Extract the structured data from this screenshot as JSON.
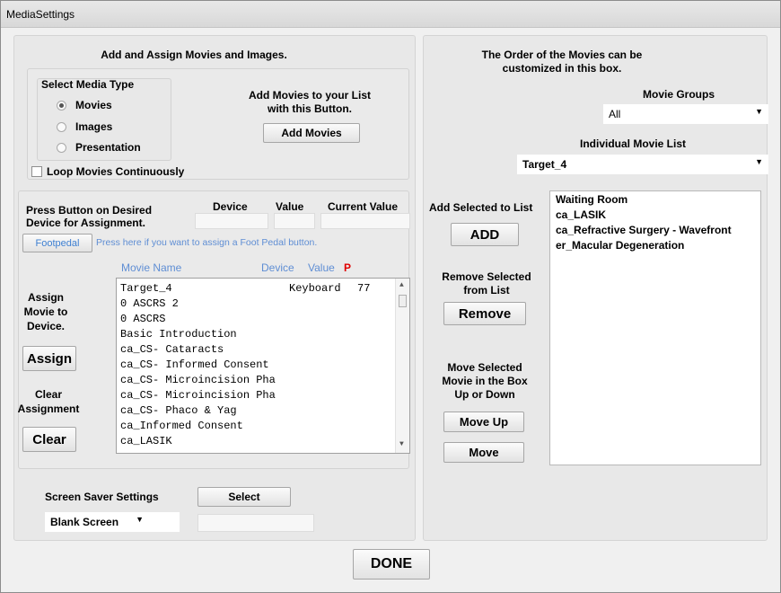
{
  "window": {
    "title": "MediaSettings"
  },
  "left_panel": {
    "heading": "Add and Assign Movies and Images.",
    "media_type": {
      "legend": "Select Media Type",
      "options": [
        {
          "label": "Movies",
          "selected": true
        },
        {
          "label": "Images",
          "selected": false
        },
        {
          "label": "Presentation",
          "selected": false
        }
      ]
    },
    "add_movies": {
      "text_line1": "Add Movies to your List",
      "text_line2": "with this Button.",
      "button": "Add Movies"
    },
    "loop": {
      "label": "Loop Movies Continuously",
      "checked": false
    },
    "assignment": {
      "instruction_line1": "Press Button on Desired",
      "instruction_line2": "Device for Assignment.",
      "col_device": "Device",
      "col_value": "Value",
      "col_current": "Current Value",
      "footpedal_button": "Footpedal",
      "footpedal_hint": "Press here if you want to assign a Foot Pedal button.",
      "list_col_movie": "Movie Name",
      "list_col_device": "Device",
      "list_col_value": "Value",
      "list_col_p": "P"
    },
    "assign_text": [
      "Assign",
      "Movie to",
      "Device."
    ],
    "assign_button": "Assign",
    "clear_text": [
      "Clear",
      "Assignment"
    ],
    "clear_button": "Clear",
    "movies": [
      {
        "name": "Target_4",
        "device": "Keyboard",
        "value": "77"
      },
      {
        "name": "0 ASCRS 2",
        "device": "",
        "value": ""
      },
      {
        "name": "0 ASCRS",
        "device": "",
        "value": ""
      },
      {
        "name": "Basic Introduction",
        "device": "",
        "value": ""
      },
      {
        "name": "ca_CS- Cataracts",
        "device": "",
        "value": ""
      },
      {
        "name": "ca_CS- Informed Consent",
        "device": "",
        "value": ""
      },
      {
        "name": "ca_CS- Microincision Pha",
        "device": "",
        "value": ""
      },
      {
        "name": "ca_CS- Microincision Pha",
        "device": "",
        "value": ""
      },
      {
        "name": "ca_CS- Phaco & Yag",
        "device": "",
        "value": ""
      },
      {
        "name": "ca_Informed Consent",
        "device": "",
        "value": ""
      },
      {
        "name": "ca_LASIK",
        "device": "",
        "value": ""
      }
    ],
    "screen_saver": {
      "label": "Screen Saver Settings",
      "select_button": "Select",
      "dropdown_value": "Blank Screen"
    }
  },
  "right_panel": {
    "heading_line1": "The Order of the Movies can be",
    "heading_line2": "customized in this box.",
    "movie_groups_label": "Movie Groups",
    "movie_groups_value": "All",
    "individual_list_label": "Individual Movie List",
    "individual_list_value": "Target_4",
    "add_label": "Add Selected to List",
    "add_button": "ADD",
    "remove_label_line1": "Remove Selected",
    "remove_label_line2": "from List",
    "remove_button": "Remove",
    "move_label": [
      "Move Selected",
      "Movie in the Box",
      "Up or Down"
    ],
    "move_up_button": "Move Up",
    "move_down_button": "Move",
    "ordered_list": [
      "Waiting Room",
      "ca_LASIK",
      "ca_Refractive Surgery - Wavefront",
      "er_Macular Degeneration"
    ]
  },
  "footer": {
    "done_button": "DONE"
  }
}
